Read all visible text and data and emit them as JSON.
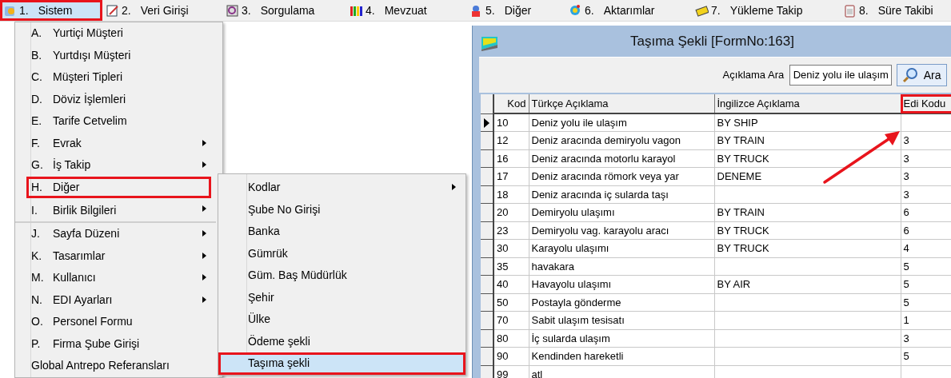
{
  "menubar": [
    {
      "key": "1.",
      "label": "Sistem",
      "selected": true,
      "outlined": true
    },
    {
      "key": "2.",
      "label": "Veri Girişi",
      "selected": false,
      "outlined": false
    },
    {
      "key": "3.",
      "label": "Sorgulama",
      "selected": false,
      "outlined": false
    },
    {
      "key": "4.",
      "label": "Mevzuat",
      "selected": false,
      "outlined": false
    },
    {
      "key": "5.",
      "label": "Diğer",
      "selected": false,
      "outlined": false
    },
    {
      "key": "6.",
      "label": "Aktarımlar",
      "selected": false,
      "outlined": false
    },
    {
      "key": "7.",
      "label": "Yükleme Takip",
      "selected": false,
      "outlined": false
    },
    {
      "key": "8.",
      "label": "Süre Takibi",
      "selected": false,
      "outlined": false
    }
  ],
  "menu": {
    "items": [
      {
        "key": "A.",
        "label": "Yurtiçi Müşteri",
        "submenu": false,
        "outlined": false,
        "separator_after": false
      },
      {
        "key": "B.",
        "label": "Yurtdışı Müşteri",
        "submenu": false,
        "outlined": false,
        "separator_after": false
      },
      {
        "key": "C.",
        "label": "Müşteri Tipleri",
        "submenu": false,
        "outlined": false,
        "separator_after": false
      },
      {
        "key": "D.",
        "label": "Döviz İşlemleri",
        "submenu": false,
        "outlined": false,
        "separator_after": false
      },
      {
        "key": "E.",
        "label": "Tarife Cetvelim",
        "submenu": false,
        "outlined": false,
        "separator_after": false
      },
      {
        "key": "F.",
        "label": "Evrak",
        "submenu": true,
        "outlined": false,
        "separator_after": false
      },
      {
        "key": "G.",
        "label": "İş Takip",
        "submenu": true,
        "outlined": false,
        "separator_after": false
      },
      {
        "key": "H.",
        "label": "Diğer",
        "submenu": false,
        "outlined": true,
        "separator_after": false
      },
      {
        "key": "I.",
        "label": "Birlik Bilgileri",
        "submenu": true,
        "outlined": false,
        "separator_after": true
      },
      {
        "key": "J.",
        "label": "Sayfa Düzeni",
        "submenu": true,
        "outlined": false,
        "separator_after": false
      },
      {
        "key": "K.",
        "label": "Tasarımlar",
        "submenu": true,
        "outlined": false,
        "separator_after": false
      },
      {
        "key": "M.",
        "label": "Kullanıcı",
        "submenu": true,
        "outlined": false,
        "separator_after": false
      },
      {
        "key": "N.",
        "label": "EDI Ayarları",
        "submenu": true,
        "outlined": false,
        "separator_after": false
      },
      {
        "key": "O.",
        "label": "Personel Formu",
        "submenu": false,
        "outlined": false,
        "separator_after": false
      },
      {
        "key": "P.",
        "label": "Firma Şube Girişi",
        "submenu": false,
        "outlined": false,
        "separator_after": false
      },
      {
        "label": "Global Antrepo Referansları",
        "submenu": false,
        "outlined": false,
        "separator_after": false
      }
    ]
  },
  "submenu": {
    "items": [
      {
        "label": "Kodlar",
        "submenu": true,
        "selected": false,
        "outlined": false
      },
      {
        "label": "Şube No Girişi",
        "submenu": false,
        "selected": false,
        "outlined": false
      },
      {
        "label": "Banka",
        "submenu": false,
        "selected": false,
        "outlined": false
      },
      {
        "label": "Gümrük",
        "submenu": false,
        "selected": false,
        "outlined": false
      },
      {
        "label": "Güm. Baş Müdürlük",
        "submenu": false,
        "selected": false,
        "outlined": false
      },
      {
        "label": "Şehir",
        "submenu": false,
        "selected": false,
        "outlined": false
      },
      {
        "label": "Ülke",
        "submenu": false,
        "selected": false,
        "outlined": false
      },
      {
        "label": "Ödeme şekli",
        "submenu": false,
        "selected": false,
        "outlined": false
      },
      {
        "label": "Taşıma şekli",
        "submenu": false,
        "selected": true,
        "outlined": true
      }
    ]
  },
  "form": {
    "title": "Taşıma Şekli [FormNo:163]",
    "search": {
      "label": "Açıklama Ara",
      "value": "Deniz yolu ile ulaşım",
      "button": "Ara"
    },
    "table": {
      "columns": [
        {
          "label": "Kod",
          "outlined": false
        },
        {
          "label": "Türkçe Açıklama",
          "outlined": false
        },
        {
          "label": "İngilizce Açıklama",
          "outlined": false
        },
        {
          "label": "Edi Kodu",
          "outlined": true
        }
      ],
      "rows": [
        {
          "current": true,
          "cells": [
            "10",
            "Deniz yolu ile ulaşım",
            "BY SHIP",
            ""
          ]
        },
        {
          "current": false,
          "cells": [
            "12",
            "Deniz aracında demiryolu vagon",
            "BY TRAIN",
            "3"
          ]
        },
        {
          "current": false,
          "cells": [
            "16",
            "Deniz aracında motorlu karayol",
            "BY TRUCK",
            "3"
          ]
        },
        {
          "current": false,
          "cells": [
            "17",
            "Deniz aracında römork veya yar",
            "DENEME",
            "3"
          ]
        },
        {
          "current": false,
          "cells": [
            "18",
            "Deniz aracında iç sularda taşı",
            "",
            "3"
          ]
        },
        {
          "current": false,
          "cells": [
            "20",
            "Demiryolu ulaşımı",
            "BY TRAIN",
            "6"
          ]
        },
        {
          "current": false,
          "cells": [
            "23",
            "Demiryolu vag. karayolu aracı",
            "BY TRUCK",
            "6"
          ]
        },
        {
          "current": false,
          "cells": [
            "30",
            "Karayolu ulaşımı",
            "BY TRUCK",
            "4"
          ]
        },
        {
          "current": false,
          "cells": [
            "35",
            "havakara",
            "",
            "5"
          ]
        },
        {
          "current": false,
          "cells": [
            "40",
            "Havayolu ulaşımı",
            "BY AIR",
            "5"
          ]
        },
        {
          "current": false,
          "cells": [
            "50",
            "Postayla gönderme",
            "",
            "5"
          ]
        },
        {
          "current": false,
          "cells": [
            "70",
            "Sabit ulaşım tesisatı",
            "",
            "1"
          ]
        },
        {
          "current": false,
          "cells": [
            "80",
            "İç sularda ulaşım",
            "",
            "3"
          ]
        },
        {
          "current": false,
          "cells": [
            "90",
            "Kendinden hareketli",
            "",
            "5"
          ]
        },
        {
          "current": false,
          "cells": [
            "99",
            "atl",
            "",
            " "
          ]
        }
      ]
    }
  },
  "annotation_arrow": true
}
